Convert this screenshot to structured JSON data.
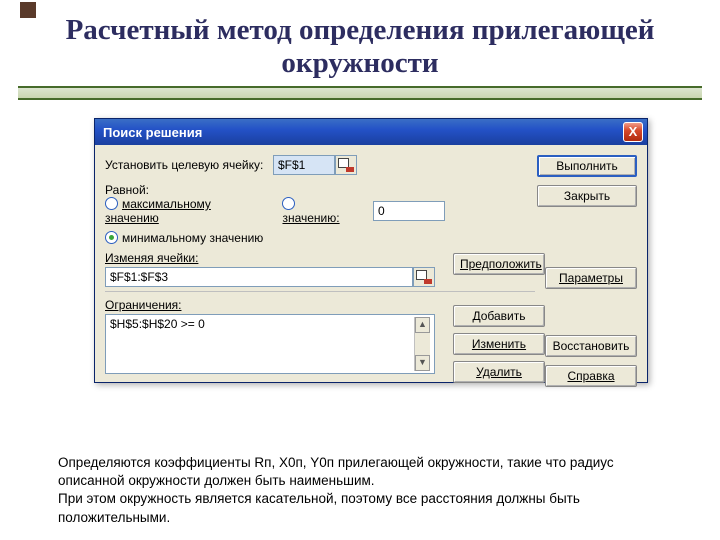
{
  "slide": {
    "title": "Расчетный метод определения прилегающей окружности"
  },
  "dialog": {
    "title": "Поиск решения",
    "close": "X",
    "target_label": "Установить целевую ячейку:",
    "target_value": "$F$1",
    "equal_label": "Равной:",
    "opt_max": "максимальному значению",
    "opt_min": "минимальному значению",
    "opt_val": "значению:",
    "val_value": "0",
    "vary_label": "Изменяя ячейки:",
    "vary_value": "$F$1:$F$3",
    "constraints_label": "Ограничения:",
    "constraint_item": "$H$5:$H$20 >= 0",
    "btn_execute": "Выполнить",
    "btn_close": "Закрыть",
    "btn_guess": "Предположить",
    "btn_params": "Параметры",
    "btn_add": "Добавить",
    "btn_change": "Изменить",
    "btn_delete": "Удалить",
    "btn_restore": "Восстановить",
    "btn_help": "Справка"
  },
  "footer": {
    "p1": "Определяются коэффициенты Rп, X0п, Y0п прилегающей окружности, такие что радиус описанной окружности должен быть наименьшим.",
    "p2": "При этом окружность является касательной, поэтому все расстояния должны быть положительными."
  }
}
